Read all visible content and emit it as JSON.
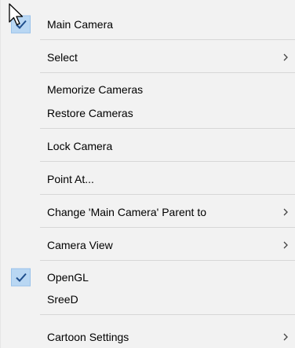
{
  "menu": {
    "items": [
      {
        "label": "Main Camera",
        "checked": true,
        "submenu": false
      },
      {
        "label": "Select",
        "checked": false,
        "submenu": true
      },
      {
        "label": "Memorize Cameras",
        "checked": false,
        "submenu": false
      },
      {
        "label": "Restore Cameras",
        "checked": false,
        "submenu": false
      },
      {
        "label": "Lock Camera",
        "checked": false,
        "submenu": false
      },
      {
        "label": "Point At...",
        "checked": false,
        "submenu": false
      },
      {
        "label": "Change 'Main Camera' Parent to",
        "checked": false,
        "submenu": true
      },
      {
        "label": "Camera View",
        "checked": false,
        "submenu": true
      },
      {
        "label": "OpenGL",
        "checked": true,
        "submenu": false
      },
      {
        "label": "SreeD",
        "checked": false,
        "submenu": false
      },
      {
        "label": "Cartoon Settings",
        "checked": false,
        "submenu": true
      }
    ],
    "submenu_icon": "chevron-right-icon",
    "check_icon": "checkmark-icon",
    "colors": {
      "background": "#f2f2f2",
      "check_highlight": "#b9d7f3",
      "separator": "#d7d7d7",
      "text": "#000000"
    }
  }
}
